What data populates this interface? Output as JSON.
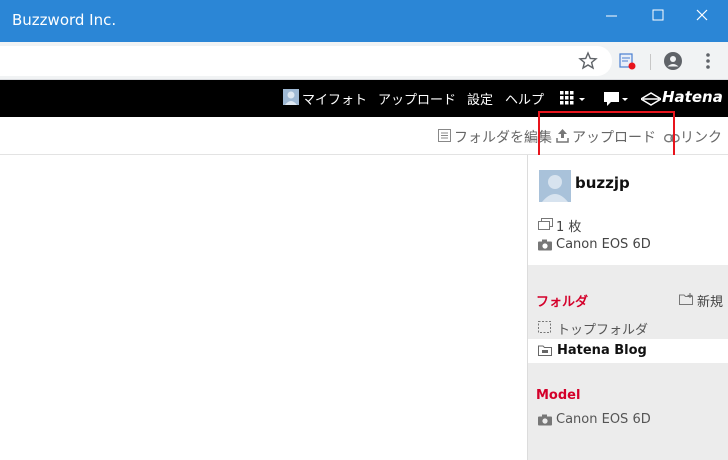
{
  "window": {
    "title": "Buzzword Inc."
  },
  "nav": {
    "my_photo": "マイフォト",
    "upload": "アップロード",
    "settings": "設定",
    "help": "ヘルプ",
    "brand": "Hatena"
  },
  "actions": {
    "edit_folders": "フォルダを編集",
    "upload": "アップロード",
    "link": "リンク"
  },
  "profile": {
    "username": "buzzjp",
    "photo_count": "1 枚",
    "camera": "Canon EOS 6D"
  },
  "folders": {
    "title": "フォルダ",
    "new_label": "新規",
    "items": [
      {
        "label": "トップフォルダ",
        "selected": false
      },
      {
        "label": "Hatena Blog",
        "selected": true
      }
    ]
  },
  "models": {
    "title": "Model",
    "items": [
      {
        "label": "Canon EOS 6D"
      }
    ]
  },
  "colors": {
    "titlebar": "#2b86d6",
    "nav_bg": "#000000",
    "section_title": "#d4002a",
    "highlight": "#e8141c"
  }
}
